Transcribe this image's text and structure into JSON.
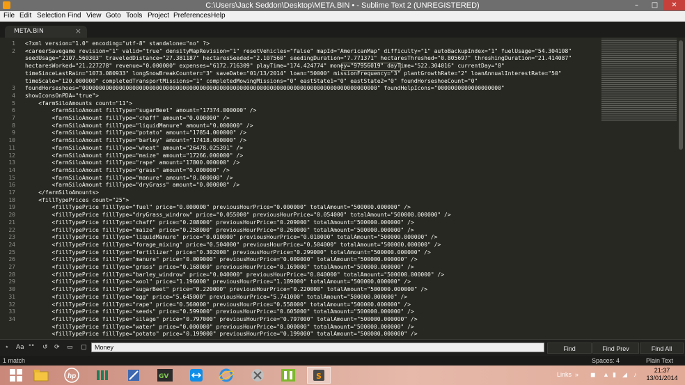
{
  "window": {
    "title": "C:\\Users\\Jack Seddon\\Desktop\\META.BIN • - Sublime Text 2 (UNREGISTERED)",
    "minimize": "–",
    "maximize": "□",
    "close": "✕"
  },
  "menu": [
    "File",
    "Edit",
    "Selection",
    "Find",
    "View",
    "Goto",
    "Tools",
    "Project",
    "Preferences",
    "Help"
  ],
  "tab": {
    "label": "META.BIN",
    "close": "×"
  },
  "editor": {
    "gutter": [
      "1",
      "2",
      "",
      "",
      "",
      "",
      "3",
      "4",
      "5",
      "6",
      "7",
      "8",
      "9",
      "10",
      "11",
      "12",
      "13",
      "14",
      "15",
      "16",
      "17",
      "18",
      "19",
      "20",
      "21",
      "22",
      "23",
      "24",
      "25",
      "26",
      "27",
      "28",
      "29",
      "30",
      "31",
      "32",
      "33",
      "34"
    ],
    "lines": [
      "<?xml version=\"1.0\" encoding=\"utf-8\" standalone=\"no\" ?>",
      "<careerSavegame revision=\"1\" valid=\"true\" densityMapRevision=\"1\" resetVehicles=\"false\" mapId=\"AmericanMap\" difficulty=\"1\" autoBackupIndex=\"1\" fuelUsage=\"54.304108\"",
      "seedUsage=\"2107.560303\" traveledDistance=\"27.381187\" hectaresSeeded=\"2.107560\" seedingDuration=\"7.771371\" hectaresThreshed=\"0.805697\" threshingDuration=\"21.414087\"",
      "hectaresWorked=\"21.227278\" revenue=\"0.000000\" expenses=\"6172.716309\" playTime=\"174.424774\" money=\"97956019\" dayTime=\"522.304016\" currentDay=\"8\"",
      "timeSinceLastRain=\"1073.080933\" longSnowBreakCounter=\"3\" saveDate=\"01/13/2014\" loan=\"50000\" missionFrequency=\"3\" plantGrowthRate=\"2\" loanAnnualInterestRate=\"50\"",
      "timeScale=\"120.000000\" completedTransportMissions=\"1\" completedMowingMissions=\"0\" eastState1=\"0\" eastState2=\"0\" foundHorseshoeCount=\"0\"",
      "foundHorseshoes=\"0000000000000000000000000000000000000000000000000000000000000000000000000000000000000000\" foundHelpIcons=\"0000000000000000000\"",
      "showIconsOnPDA=\"true\">",
      "    <farmSiloAmounts count=\"11\">",
      "        <farmSiloAmount fillType=\"sugarBeet\" amount=\"17374.000000\" />",
      "        <farmSiloAmount fillType=\"chaff\" amount=\"0.000000\" />",
      "        <farmSiloAmount fillType=\"liquidManure\" amount=\"0.000000\" />",
      "        <farmSiloAmount fillType=\"potato\" amount=\"17854.000000\" />",
      "        <farmSiloAmount fillType=\"barley\" amount=\"17418.000000\" />",
      "        <farmSiloAmount fillType=\"wheat\" amount=\"26478.025391\" />",
      "        <farmSiloAmount fillType=\"maize\" amount=\"17266.000000\" />",
      "        <farmSiloAmount fillType=\"rape\" amount=\"17800.000000\" />",
      "        <farmSiloAmount fillType=\"grass\" amount=\"0.000000\" />",
      "        <farmSiloAmount fillType=\"manure\" amount=\"0.000000\" />",
      "        <farmSiloAmount fillType=\"dryGrass\" amount=\"0.000000\" />",
      "    </farmSiloAmounts>",
      "    <fillTypePrices count=\"25\">",
      "        <fillTypePrice fillType=\"fuel\" price=\"0.000000\" previousHourPrice=\"0.000000\" totalAmount=\"500000.000000\" />",
      "        <fillTypePrice fillType=\"dryGrass_windrow\" price=\"0.055000\" previousHourPrice=\"0.054000\" totalAmount=\"500000.000000\" />",
      "        <fillTypePrice fillType=\"chaff\" price=\"0.208000\" previousHourPrice=\"0.209000\" totalAmount=\"500000.000000\" />",
      "        <fillTypePrice fillType=\"maize\" price=\"0.258000\" previousHourPrice=\"0.260000\" totalAmount=\"500000.000000\" />",
      "        <fillTypePrice fillType=\"liquidManure\" price=\"0.010000\" previousHourPrice=\"0.010000\" totalAmount=\"500000.000000\" />",
      "        <fillTypePrice fillType=\"forage_mixing\" price=\"0.504000\" previousHourPrice=\"0.504000\" totalAmount=\"500000.000000\" />",
      "        <fillTypePrice fillType=\"fertilizer\" price=\"0.302000\" previousHourPrice=\"0.299000\" totalAmount=\"500000.000000\" />",
      "        <fillTypePrice fillType=\"manure\" price=\"0.009000\" previousHourPrice=\"0.009000\" totalAmount=\"500000.000000\" />",
      "        <fillTypePrice fillType=\"grass\" price=\"0.168000\" previousHourPrice=\"0.169000\" totalAmount=\"500000.000000\" />",
      "        <fillTypePrice fillType=\"barley_windrow\" price=\"0.040000\" previousHourPrice=\"0.040000\" totalAmount=\"500000.000000\" />",
      "        <fillTypePrice fillType=\"wool\" price=\"1.196000\" previousHourPrice=\"1.189000\" totalAmount=\"500000.000000\" />",
      "        <fillTypePrice fillType=\"sugarBeet\" price=\"0.220000\" previousHourPrice=\"0.220000\" totalAmount=\"500000.000000\" />",
      "        <fillTypePrice fillType=\"egg\" price=\"5.645000\" previousHourPrice=\"5.741000\" totalAmount=\"500000.000000\" />",
      "        <fillTypePrice fillType=\"rape\" price=\"0.560000\" previousHourPrice=\"0.558000\" totalAmount=\"500000.000000\" />",
      "        <fillTypePrice fillType=\"seeds\" price=\"0.599000\" previousHourPrice=\"0.605000\" totalAmount=\"500000.000000\" />",
      "        <fillTypePrice fillType=\"silage\" price=\"0.797000\" previousHourPrice=\"0.797000\" totalAmount=\"500000.000000\" />",
      "        <fillTypePrice fillType=\"water\" price=\"0.000000\" previousHourPrice=\"0.000000\" totalAmount=\"500000.000000\" />",
      "        <fillTypePrice fillType=\"potato\" price=\"0.199000\" previousHourPrice=\"0.199000\" totalAmount=\"500000.000000\" />"
    ],
    "highlighted_text": "money=\"97956019\""
  },
  "find": {
    "options": [
      "⋆",
      "Aa",
      "\"\"",
      "↺",
      "⟳",
      "▭",
      "▢"
    ],
    "value": "Money",
    "buttons": {
      "find": "Find",
      "find_prev": "Find Prev",
      "find_all": "Find All"
    }
  },
  "status": {
    "left": "1 match",
    "spaces": "Spaces: 4",
    "syntax": "Plain Text"
  },
  "taskbar": {
    "apps": [
      "start-icon",
      "file-explorer-icon",
      "hp-icon",
      "jt-icon",
      "app-icon",
      "gta-icon",
      "teamviewer-icon",
      "ie-icon",
      "xbox-icon",
      "farming-simulator-icon",
      "sublime-text-icon"
    ],
    "links_label": "Links",
    "time": "21:37",
    "date": "13/01/2014"
  },
  "colors": {
    "editor_bg": "#272822",
    "text": "#f8f8f2",
    "line_numbers": "#8f908a",
    "titlebar": "#6f6e6e",
    "close_button": "#c7403a",
    "taskbar": "#d9a797"
  }
}
